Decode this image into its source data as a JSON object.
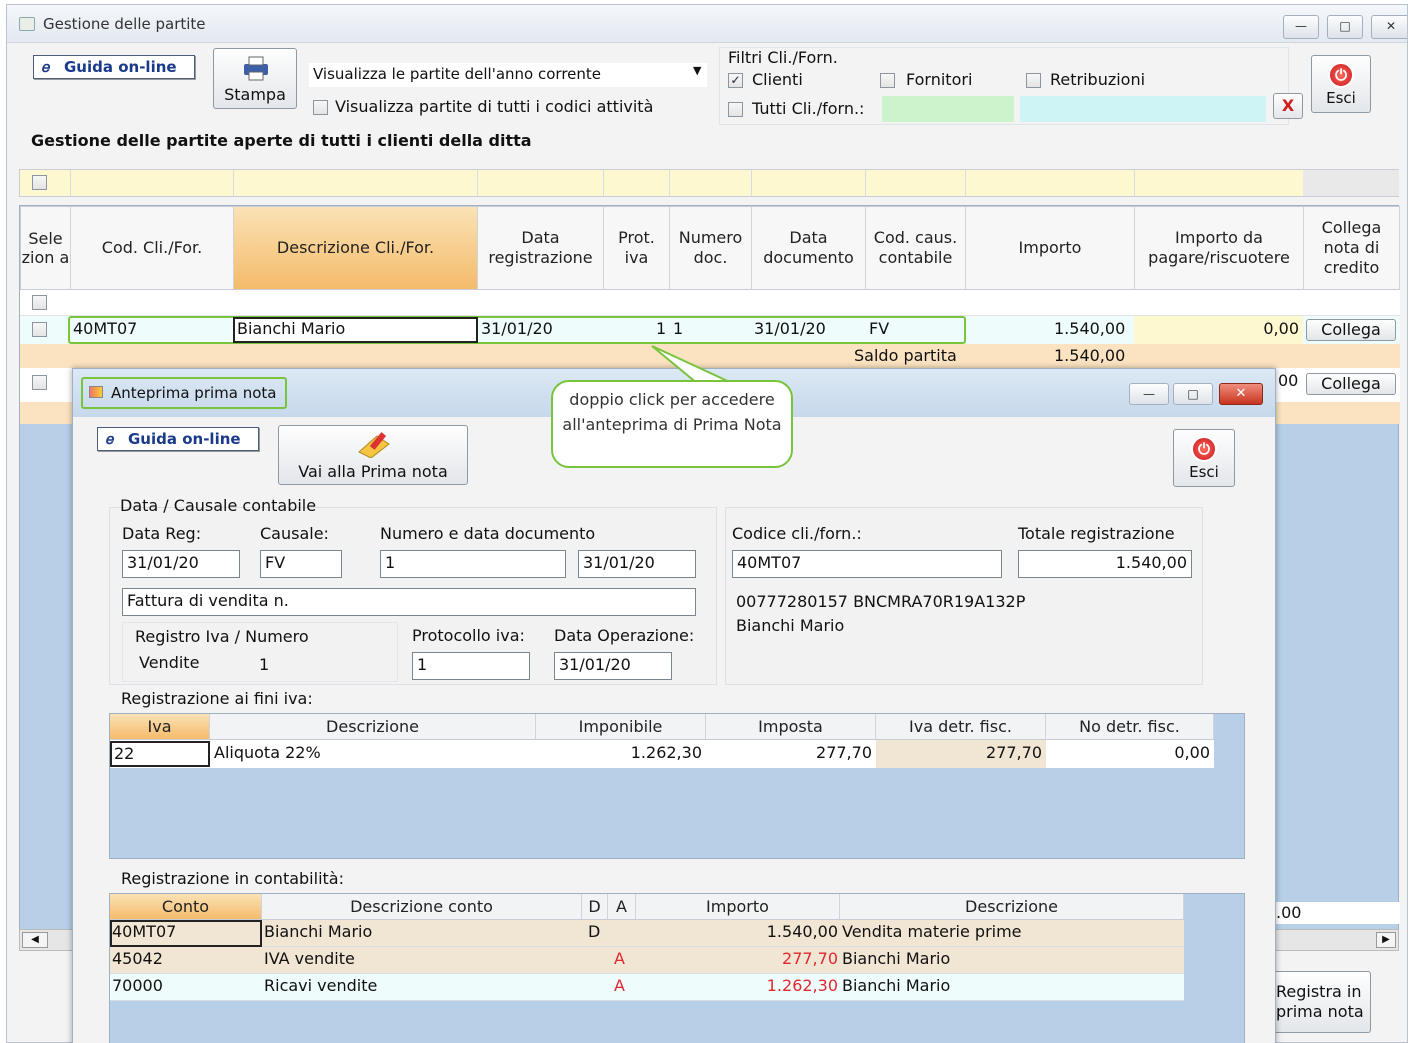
{
  "main_window": {
    "title": "Gestione delle partite",
    "guida_label": "Guida on-line",
    "stampa_label": "Stampa",
    "view_select_value": "Visualizza le partite dell'anno corrente",
    "all_codes_label": "Visualizza partite di tutti i codici attività",
    "filter_title": "Filtri Cli./Forn.",
    "filter_clienti": "Clienti",
    "filter_fornitori": "Fornitori",
    "filter_retribuzioni": "Retribuzioni",
    "filter_tutti": "Tutti Cli./forn.:",
    "clear_label": "X",
    "esci_label": "Esci",
    "heading": "Gestione delle partite aperte di tutti i clienti della ditta"
  },
  "grid": {
    "headers": [
      "Sele zion a",
      "Cod. Cli./For.",
      "Descrizione Cli./For.",
      "Data registrazione",
      "Prot. iva",
      "Numero doc.",
      "Data documento",
      "Cod. caus. contabile",
      "Importo",
      "Importo da pagare/riscuotere",
      "Collega nota di credito"
    ],
    "row": {
      "cod": "40MT07",
      "descrizione": "Bianchi Mario",
      "data_reg": "31/01/20",
      "prot": "1",
      "num": "1",
      "data_doc": "31/01/20",
      "causale": "FV",
      "importo": "1.540,00",
      "da_pagare": "0,00",
      "collega": "Collega"
    },
    "saldo_label": "Saldo partita",
    "saldo_value": "1.540,00",
    "row2_fragment": "00",
    "row2_collega": "Collega",
    "bottom_fragment": ".00",
    "registra_label": "Registra in prima nota"
  },
  "callout": {
    "text": "doppio click per accedere all'anteprima di Prima Nota"
  },
  "dialog": {
    "title": "Anteprima prima nota",
    "guida_label": "Guida on-line",
    "vai_label": "Vai alla Prima nota",
    "esci_label": "Esci",
    "section_data": "Data / Causale contabile",
    "data_reg_label": "Data Reg:",
    "data_reg": "31/01/20",
    "causale_label": "Causale:",
    "causale": "FV",
    "num_data_label": "Numero e data documento",
    "num_doc": "1",
    "data_doc": "31/01/20",
    "descrizione": "Fattura di vendita n.",
    "registro_label": "Registro Iva / Numero",
    "registro": "Vendite",
    "registro_num": "1",
    "protocollo_label": "Protocollo iva:",
    "protocollo": "1",
    "data_op_label": "Data Operazione:",
    "data_op": "31/01/20",
    "codice_label": "Codice cli./forn.:",
    "codice": "40MT07",
    "totale_label": "Totale registrazione",
    "totale": "1.540,00",
    "piva_cf": "00777280157 BNCMRA70R19A132P",
    "nome": "Bianchi Mario",
    "iva_section": "Registrazione ai fini iva:",
    "iva_headers": [
      "Iva",
      "Descrizione",
      "Imponibile",
      "Imposta",
      "Iva detr. fisc.",
      "No detr. fisc."
    ],
    "iva_row": {
      "iva": "22",
      "descrizione": "Aliquota 22%",
      "imponibile": "1.262,30",
      "imposta": "277,70",
      "detr": "277,70",
      "nodetr": "0,00"
    },
    "cont_section": "Registrazione in contabilità:",
    "cont_headers": [
      "Conto",
      "Descrizione conto",
      "D",
      "A",
      "Importo",
      "Descrizione"
    ],
    "cont_rows": [
      {
        "conto": "40MT07",
        "descr": "Bianchi Mario",
        "d": "D",
        "a": "",
        "importo": "1.540,00",
        "descrizione": "Vendita materie prime"
      },
      {
        "conto": "45042",
        "descr": "IVA vendite",
        "d": "",
        "a": "A",
        "importo": "277,70",
        "descrizione": "Bianchi Mario"
      },
      {
        "conto": "70000",
        "descr": "Ricavi vendite",
        "d": "",
        "a": "A",
        "importo": "1.262,30",
        "descrizione": "Bianchi Mario"
      }
    ]
  },
  "colors": {
    "accent_green": "#78c43d",
    "orange_header": "#f6c37a",
    "red_amount": "#e0282f"
  }
}
